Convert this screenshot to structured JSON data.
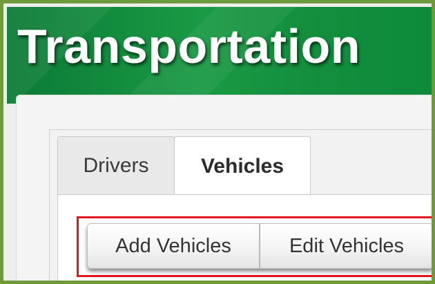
{
  "header": {
    "title": "Transportation"
  },
  "tabs": [
    {
      "label": "Drivers",
      "active": false
    },
    {
      "label": "Vehicles",
      "active": true
    }
  ],
  "actions": {
    "add_label": "Add Vehicles",
    "edit_label": "Edit Vehicles"
  },
  "colors": {
    "header_green": "#1a9a44",
    "frame_border": "#6e9a3c",
    "highlight_red": "#e0141c"
  }
}
